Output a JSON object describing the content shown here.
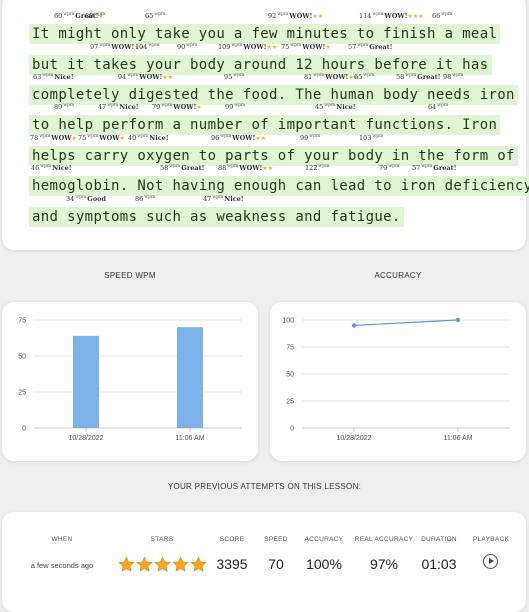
{
  "lesson": {
    "lines": [
      "It might only take you a few minutes to finish a meal",
      "but it takes your body around 12 hours before it has",
      "completely digested the food. The human body needs iron",
      "to help perform a number of important functions. Iron",
      "helps carry oxygen to parts of your body in the form of",
      "hemoglobin. Not having enough can lead to iron deficiency",
      "and symptoms such as weakness and fatigue."
    ],
    "wpm_unit": "wpm",
    "annotations": [
      {
        "n": "60",
        "label": "Great!",
        "stars": "★",
        "row": 0
      },
      {
        "n": "80",
        "label": "",
        "stars": "",
        "row": 0
      },
      {
        "n": "65",
        "label": "",
        "stars": "",
        "row": 0
      },
      {
        "n": "92",
        "label": "WOW!",
        "stars": "★★",
        "row": 0
      },
      {
        "n": "114",
        "label": "WOW!",
        "stars": "★★★",
        "row": 0
      },
      {
        "n": "66",
        "label": "",
        "stars": "",
        "row": 0
      },
      {
        "n": "97",
        "label": "WOW!",
        "stars": "★★",
        "row": 1
      },
      {
        "n": "104",
        "label": "",
        "stars": "",
        "row": 1
      },
      {
        "n": "90",
        "label": "",
        "stars": "",
        "row": 1
      },
      {
        "n": "109",
        "label": "WOW!",
        "stars": "★★",
        "row": 1
      },
      {
        "n": "75",
        "label": "WOW!",
        "stars": "★",
        "row": 1
      },
      {
        "n": "57",
        "label": "Great!",
        "stars": "",
        "row": 1
      },
      {
        "n": "63",
        "label": "Nice!",
        "stars": "",
        "row": 2
      },
      {
        "n": "94",
        "label": "WOW!",
        "stars": "★★",
        "row": 2
      },
      {
        "n": "95",
        "label": "",
        "stars": "",
        "row": 2
      },
      {
        "n": "81",
        "label": "WOW!",
        "stars": "★★",
        "row": 2
      },
      {
        "n": "65",
        "label": "",
        "stars": "",
        "row": 2
      },
      {
        "n": "58",
        "label": "Great!",
        "stars": "",
        "row": 2
      },
      {
        "n": "98",
        "label": "",
        "stars": "",
        "row": 2
      },
      {
        "n": "89",
        "label": "",
        "stars": "",
        "row": 3
      },
      {
        "n": "47",
        "label": "Nice!",
        "stars": "",
        "row": 3
      },
      {
        "n": "79",
        "label": "WOW!",
        "stars": "★",
        "row": 3
      },
      {
        "n": "99",
        "label": "",
        "stars": "",
        "row": 3
      },
      {
        "n": "45",
        "label": "Nice!",
        "stars": "",
        "row": 3
      },
      {
        "n": "64",
        "label": "",
        "stars": "",
        "row": 3
      },
      {
        "n": "78",
        "label": "WOW",
        "stars": "★",
        "row": 4
      },
      {
        "n": "75",
        "label": "WOW",
        "stars": "★",
        "row": 4
      },
      {
        "n": "40",
        "label": "Nice!",
        "stars": "",
        "row": 4
      },
      {
        "n": "96",
        "label": "WOW!",
        "stars": "★★",
        "row": 4
      },
      {
        "n": "99",
        "label": "",
        "stars": "",
        "row": 4
      },
      {
        "n": "103",
        "label": "",
        "stars": "",
        "row": 4
      },
      {
        "n": "46",
        "label": "Nice!",
        "stars": "",
        "row": 5
      },
      {
        "n": "58",
        "label": "Great!",
        "stars": "",
        "row": 5
      },
      {
        "n": "88",
        "label": "WOW!",
        "stars": "★★",
        "row": 5
      },
      {
        "n": "122",
        "label": "",
        "stars": "",
        "row": 5
      },
      {
        "n": "79",
        "label": "",
        "stars": "",
        "row": 5
      },
      {
        "n": "57",
        "label": "Great!",
        "stars": "",
        "row": 5
      },
      {
        "n": "34",
        "label": "Good",
        "stars": "",
        "row": 6
      },
      {
        "n": "86",
        "label": "",
        "stars": "",
        "row": 6
      },
      {
        "n": "47",
        "label": "Nice!",
        "stars": "",
        "row": 6
      }
    ]
  },
  "speed": {
    "title": "SPEED WPM",
    "chart_data": {
      "type": "bar",
      "categories": [
        "10/28/2022",
        "11:06 AM"
      ],
      "values": [
        64,
        70
      ],
      "ylim": [
        0,
        75
      ],
      "yticks": [
        "0",
        "25",
        "50",
        "75"
      ],
      "color": "#7cb2e8"
    }
  },
  "accuracy": {
    "title": "ACCURACY",
    "chart_data": {
      "type": "line",
      "categories": [
        "10/28/2022",
        "11:06 AM"
      ],
      "values": [
        95,
        100
      ],
      "ylim": [
        0,
        100
      ],
      "yticks": [
        "0",
        "25",
        "50",
        "75",
        "100"
      ],
      "color": "#5b9bd8"
    }
  },
  "attempts": {
    "title": "YOUR PREVIOUS ATTEMPTS ON THIS LESSON:",
    "headers": {
      "when": "WHEN",
      "stars": "STARS",
      "score": "SCORE",
      "speed": "SPEED",
      "accuracy": "ACCURACY",
      "real_accuracy": "REAL ACCURACY",
      "duration": "DURATION",
      "playback": "PLAYBACK"
    },
    "rows": [
      {
        "when": "a few seconds ago",
        "stars": 5,
        "score": "3395",
        "speed": "70",
        "accuracy": "100%",
        "real_accuracy": "97%",
        "duration": "01:03"
      }
    ],
    "star_color": "#f5a623"
  }
}
